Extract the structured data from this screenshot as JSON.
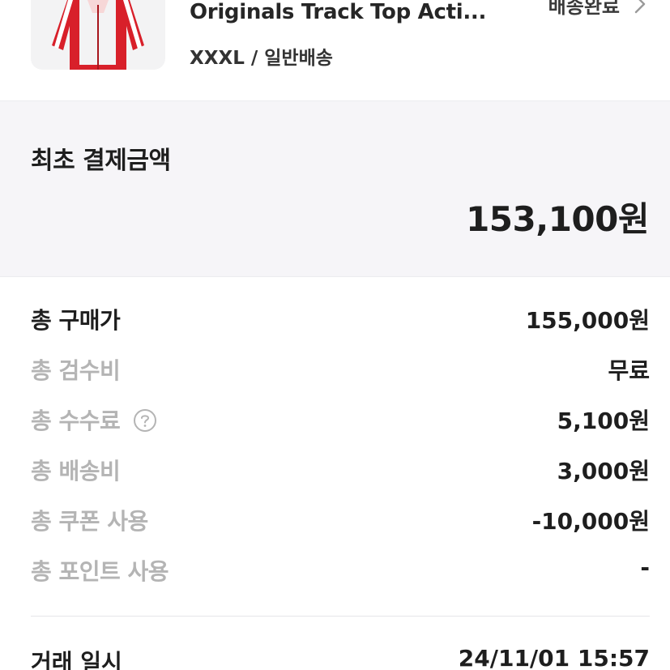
{
  "product": {
    "title": "Originals Track Top Acti...",
    "option": "XXXL / 일반배송",
    "status": "배송완료",
    "thumbnail_icon": "red-track-jacket-image"
  },
  "initial_payment": {
    "label": "최초 결제금액",
    "amount": "153,100원"
  },
  "breakdown": [
    {
      "label": "총 구매가",
      "value": "155,000원"
    },
    {
      "label": "총 검수비",
      "value": "무료"
    },
    {
      "label": "총 수수료",
      "value": "5,100원"
    },
    {
      "label": "총 배송비",
      "value": "3,000원"
    },
    {
      "label": "총 쿠폰 사용",
      "value": "-10,000원"
    },
    {
      "label": "총 포인트 사용",
      "value": "-"
    }
  ],
  "trade": {
    "label": "거래 일시",
    "value": "24/11/01 15:57"
  },
  "colors": {
    "text_primary": "#1e1e1e",
    "text_muted": "#b4b4b4",
    "section_bg": "#f6f5f8",
    "jacket_red": "#d8202a"
  }
}
